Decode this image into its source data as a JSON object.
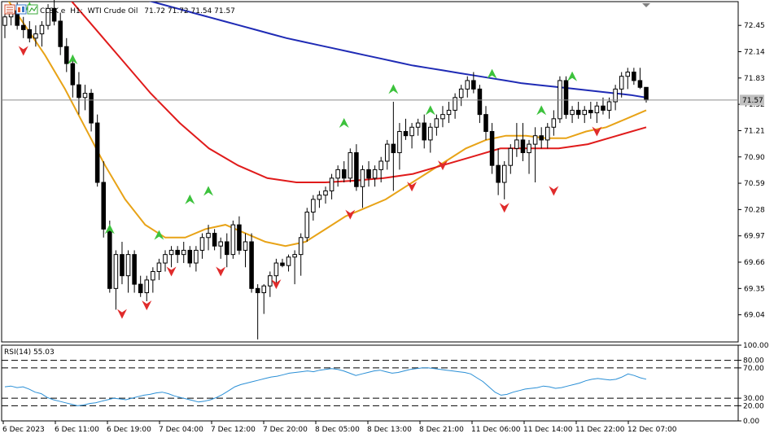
{
  "header": {
    "symbol": "CLSK e",
    "timeframe": "H1:",
    "instrument": "WTI Crude Oil",
    "ohlc": "71.72 71.72 71.54 71.57"
  },
  "chart_data": {
    "type": "candlestick",
    "price_axis": {
      "ticks": [
        "72.45",
        "72.14",
        "71.83",
        "71.52",
        "71.21",
        "70.90",
        "70.59",
        "70.28",
        "69.97",
        "69.66",
        "69.35",
        "69.04"
      ],
      "ylim": [
        68.72,
        72.73
      ],
      "current_price": 71.57,
      "current_price_label": "71.57"
    },
    "time_axis": {
      "labels": [
        "6 Dec 2023",
        "6 Dec 11:00",
        "6 Dec 19:00",
        "7 Dec 04:00",
        "7 Dec 12:00",
        "7 Dec 20:00",
        "8 Dec 05:00",
        "8 Dec 13:00",
        "8 Dec 21:00",
        "11 Dec 06:00",
        "11 Dec 14:00",
        "11 Dec 22:00",
        "12 Dec 07:00"
      ]
    },
    "candles": [
      [
        72.45,
        72.6,
        72.3,
        72.55
      ],
      [
        72.55,
        72.7,
        72.45,
        72.65
      ],
      [
        72.62,
        72.72,
        72.4,
        72.45
      ],
      [
        72.45,
        72.55,
        72.3,
        72.4
      ],
      [
        72.4,
        72.5,
        72.25,
        72.3
      ],
      [
        72.3,
        72.45,
        72.2,
        72.35
      ],
      [
        72.35,
        72.5,
        72.2,
        72.45
      ],
      [
        72.45,
        72.7,
        72.4,
        72.65
      ],
      [
        72.65,
        72.75,
        72.45,
        72.5
      ],
      [
        72.5,
        72.6,
        72.1,
        72.2
      ],
      [
        72.2,
        72.3,
        71.9,
        72.0
      ],
      [
        72.0,
        72.1,
        71.6,
        71.75
      ],
      [
        71.75,
        71.9,
        71.4,
        71.6
      ],
      [
        71.6,
        71.75,
        71.45,
        71.65
      ],
      [
        71.65,
        71.7,
        71.2,
        71.3
      ],
      [
        71.3,
        71.4,
        70.55,
        70.6
      ],
      [
        70.6,
        70.85,
        69.95,
        70.05
      ],
      [
        70.05,
        70.15,
        69.3,
        69.35
      ],
      [
        69.35,
        69.8,
        69.1,
        69.75
      ],
      [
        69.75,
        69.9,
        69.4,
        69.5
      ],
      [
        69.5,
        69.8,
        69.3,
        69.75
      ],
      [
        69.75,
        69.8,
        69.3,
        69.4
      ],
      [
        69.4,
        69.5,
        69.25,
        69.3
      ],
      [
        69.3,
        69.5,
        69.2,
        69.45
      ],
      [
        69.45,
        69.6,
        69.3,
        69.55
      ],
      [
        69.55,
        69.7,
        69.45,
        69.65
      ],
      [
        69.65,
        69.8,
        69.55,
        69.75
      ],
      [
        69.75,
        69.85,
        69.6,
        69.8
      ],
      [
        69.8,
        69.85,
        69.65,
        69.75
      ],
      [
        69.75,
        69.9,
        69.65,
        69.8
      ],
      [
        69.8,
        69.85,
        69.6,
        69.65
      ],
      [
        69.65,
        69.85,
        69.55,
        69.8
      ],
      [
        69.8,
        70.0,
        69.7,
        69.95
      ],
      [
        69.95,
        70.1,
        69.8,
        70.0
      ],
      [
        70.0,
        70.05,
        69.8,
        69.85
      ],
      [
        69.85,
        69.95,
        69.7,
        69.9
      ],
      [
        69.9,
        70.0,
        69.6,
        69.75
      ],
      [
        69.75,
        70.15,
        69.7,
        70.1
      ],
      [
        70.1,
        70.2,
        69.75,
        69.8
      ],
      [
        69.8,
        70.0,
        69.6,
        69.9
      ],
      [
        69.9,
        70.0,
        69.3,
        69.35
      ],
      [
        69.35,
        69.4,
        68.75,
        69.3
      ],
      [
        69.3,
        69.4,
        69.05,
        69.38
      ],
      [
        69.38,
        69.55,
        69.25,
        69.5
      ],
      [
        69.5,
        69.7,
        69.4,
        69.65
      ],
      [
        69.65,
        69.7,
        69.6,
        69.62
      ],
      [
        69.62,
        69.75,
        69.55,
        69.72
      ],
      [
        69.72,
        69.8,
        69.4,
        69.75
      ],
      [
        69.75,
        70.0,
        69.5,
        69.95
      ],
      [
        69.95,
        70.3,
        69.9,
        70.25
      ],
      [
        70.25,
        70.45,
        70.15,
        70.4
      ],
      [
        70.4,
        70.5,
        70.3,
        70.45
      ],
      [
        70.45,
        70.55,
        70.35,
        70.5
      ],
      [
        70.5,
        70.7,
        70.4,
        70.65
      ],
      [
        70.65,
        70.8,
        70.55,
        70.75
      ],
      [
        70.75,
        70.85,
        70.6,
        70.65
      ],
      [
        70.65,
        71.0,
        70.6,
        70.95
      ],
      [
        70.95,
        71.05,
        70.5,
        70.55
      ],
      [
        70.55,
        70.8,
        70.3,
        70.75
      ],
      [
        70.75,
        70.85,
        70.55,
        70.65
      ],
      [
        70.65,
        70.8,
        70.55,
        70.75
      ],
      [
        70.75,
        70.9,
        70.6,
        70.85
      ],
      [
        70.85,
        71.1,
        70.75,
        71.05
      ],
      [
        71.05,
        71.55,
        70.5,
        70.95
      ],
      [
        70.95,
        71.3,
        70.75,
        71.2
      ],
      [
        71.2,
        71.35,
        71.1,
        71.15
      ],
      [
        71.15,
        71.3,
        71.0,
        71.25
      ],
      [
        71.25,
        71.35,
        71.15,
        71.3
      ],
      [
        71.3,
        71.4,
        71.0,
        71.1
      ],
      [
        71.1,
        71.3,
        70.95,
        71.25
      ],
      [
        71.25,
        71.4,
        71.15,
        71.35
      ],
      [
        71.35,
        71.5,
        71.25,
        71.4
      ],
      [
        71.4,
        71.55,
        71.3,
        71.45
      ],
      [
        71.45,
        71.65,
        71.35,
        71.6
      ],
      [
        71.6,
        71.75,
        71.5,
        71.7
      ],
      [
        71.7,
        71.85,
        71.6,
        71.8
      ],
      [
        71.8,
        71.9,
        71.65,
        71.7
      ],
      [
        71.7,
        71.75,
        71.3,
        71.4
      ],
      [
        71.4,
        71.5,
        71.1,
        71.2
      ],
      [
        71.2,
        71.3,
        70.7,
        70.8
      ],
      [
        70.8,
        71.0,
        70.45,
        70.6
      ],
      [
        70.6,
        70.85,
        70.4,
        70.8
      ],
      [
        70.8,
        71.05,
        70.7,
        71.0
      ],
      [
        71.0,
        71.3,
        70.9,
        71.1
      ],
      [
        71.1,
        71.3,
        70.85,
        70.95
      ],
      [
        70.95,
        71.1,
        70.7,
        71.05
      ],
      [
        71.05,
        71.25,
        70.6,
        71.15
      ],
      [
        71.15,
        71.25,
        71.0,
        71.1
      ],
      [
        71.1,
        71.3,
        71.0,
        71.25
      ],
      [
        71.25,
        71.45,
        71.15,
        71.35
      ],
      [
        71.35,
        71.85,
        71.3,
        71.8
      ],
      [
        71.8,
        71.85,
        71.35,
        71.4
      ],
      [
        71.4,
        71.5,
        71.3,
        71.45
      ],
      [
        71.45,
        71.55,
        71.35,
        71.4
      ],
      [
        71.4,
        71.5,
        71.3,
        71.45
      ],
      [
        71.45,
        71.55,
        71.35,
        71.42
      ],
      [
        71.42,
        71.55,
        71.3,
        71.5
      ],
      [
        71.5,
        71.6,
        71.4,
        71.45
      ],
      [
        71.45,
        71.6,
        71.35,
        71.55
      ],
      [
        71.55,
        71.75,
        71.45,
        71.7
      ],
      [
        71.7,
        71.9,
        71.6,
        71.85
      ],
      [
        71.85,
        71.95,
        71.7,
        71.9
      ],
      [
        71.9,
        71.95,
        71.75,
        71.8
      ],
      [
        71.8,
        71.95,
        71.7,
        71.72
      ],
      [
        71.72,
        71.72,
        71.54,
        71.57
      ]
    ],
    "moving_averages": [
      {
        "color": "#1f2bb5",
        "values": [
          73.2,
          73.15,
          73.1,
          73.05,
          73.0,
          72.95,
          72.9,
          72.85,
          72.8,
          72.75,
          72.7,
          72.65,
          72.6,
          72.55,
          72.5,
          72.45,
          72.4,
          72.35,
          72.3,
          72.26,
          72.22,
          72.18,
          72.14,
          72.1,
          72.06,
          72.02,
          71.98,
          71.95,
          71.92,
          71.89,
          71.86,
          71.83,
          71.8,
          71.77,
          71.75,
          71.73,
          71.71,
          71.69,
          71.67,
          71.65,
          71.63,
          71.6
        ]
      },
      {
        "color": "#e8a317",
        "values": [
          72.8,
          72.45,
          72.1,
          71.7,
          71.25,
          70.8,
          70.4,
          70.1,
          69.95,
          69.95,
          70.05,
          70.1,
          70.0,
          69.9,
          69.85,
          69.9,
          70.05,
          70.2,
          70.3,
          70.4,
          70.55,
          70.7,
          70.85,
          71.0,
          71.1,
          71.15,
          71.15,
          71.12,
          71.12,
          71.2,
          71.25,
          71.35,
          71.45
        ]
      },
      {
        "color": "#e01b1b",
        "values": [
          73.5,
          73.2,
          72.85,
          72.45,
          72.05,
          71.65,
          71.3,
          71.0,
          70.8,
          70.65,
          70.6,
          70.6,
          70.62,
          70.65,
          70.7,
          70.8,
          70.9,
          71.0,
          71.0,
          71.0,
          71.05,
          71.15,
          71.25
        ]
      }
    ],
    "signals_up": [
      [
        4,
        72.67
      ],
      [
        11,
        72.05
      ],
      [
        17,
        70.05
      ],
      [
        25,
        69.98
      ],
      [
        30,
        70.4
      ],
      [
        33,
        70.5
      ],
      [
        55,
        71.3
      ],
      [
        63,
        71.7
      ],
      [
        69,
        71.45
      ],
      [
        79,
        71.88
      ],
      [
        87,
        71.45
      ],
      [
        92,
        71.85
      ]
    ],
    "signals_down": [
      [
        3,
        72.15
      ],
      [
        19,
        69.05
      ],
      [
        23,
        69.15
      ],
      [
        27,
        69.55
      ],
      [
        35,
        69.55
      ],
      [
        44,
        69.4
      ],
      [
        56,
        70.22
      ],
      [
        66,
        70.55
      ],
      [
        71,
        70.8
      ],
      [
        81,
        70.3
      ],
      [
        89,
        70.5
      ],
      [
        96,
        71.2
      ]
    ],
    "rsi": {
      "label": "RSI(14) 55.03",
      "period": 14,
      "value": 55.03,
      "levels": [
        80,
        70,
        30,
        20
      ],
      "ticks": [
        "100.00",
        "80.00",
        "70.00",
        "30.00",
        "20.00",
        "0.00"
      ],
      "values": [
        45,
        46,
        44,
        45,
        42,
        38,
        36,
        31,
        28,
        26,
        24,
        22,
        20,
        21,
        23,
        24,
        26,
        28,
        30,
        29,
        28,
        30,
        32,
        34,
        35,
        37,
        38,
        36,
        33,
        31,
        29,
        27,
        25,
        26,
        28,
        31,
        35,
        40,
        45,
        48,
        50,
        52,
        54,
        56,
        58,
        59,
        61,
        63,
        64,
        65,
        66,
        65,
        67,
        68,
        69,
        68,
        66,
        63,
        60,
        62,
        64,
        66,
        67,
        65,
        63,
        64,
        66,
        68,
        69,
        70,
        70,
        69,
        68,
        67,
        66,
        65,
        64,
        62,
        57,
        52,
        45,
        38,
        34,
        35,
        38,
        40,
        42,
        43,
        44,
        46,
        45,
        43,
        44,
        46,
        48,
        50,
        53,
        55,
        56,
        55,
        54,
        55,
        58,
        62,
        60,
        57,
        55.03
      ]
    }
  }
}
